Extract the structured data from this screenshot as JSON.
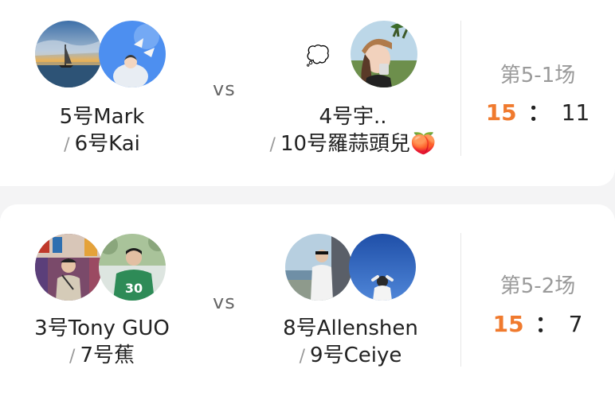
{
  "matches": [
    {
      "left": {
        "line1": "5号Mark",
        "slash": "/",
        "line2": "6号Kai"
      },
      "vs": "vs",
      "right": {
        "decoration": "💭",
        "line1": "4号宇..",
        "slash": "/",
        "line2": "10号羅蒜頭兒🍑"
      },
      "round": "第5-1场",
      "score": {
        "left": "15",
        "colon": "：",
        "right": "11"
      }
    },
    {
      "left": {
        "line1": "3号Tony GUO",
        "slash": "/",
        "line2": "7号蕉"
      },
      "vs": "vs",
      "right": {
        "line1": "8号Allenshen",
        "slash": "/",
        "line2": "9号Ceiye"
      },
      "round": "第5-2场",
      "score": {
        "left": "15",
        "colon": "：",
        "right": "7"
      }
    }
  ],
  "colors": {
    "accent": "#f07a2e",
    "muted": "#9a9a9a",
    "background": "#f4f4f5"
  }
}
